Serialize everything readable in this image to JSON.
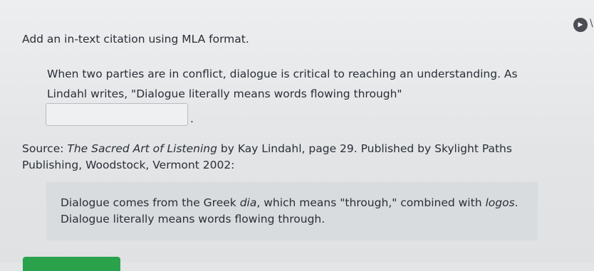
{
  "header": {
    "icon": "play-circle-icon",
    "icon_glyph": "▶",
    "edge_glyph": "\\"
  },
  "question": {
    "prompt": "Add an in-text citation using MLA format.",
    "passage_line1": "When two parties are in conflict, dialogue is critical to reaching an understanding. As",
    "passage_line2": "Lindahl writes, \"Dialogue literally means words flowing through\"",
    "citation_value": "",
    "citation_placeholder": "",
    "period": "."
  },
  "source": {
    "label": "Source: ",
    "book_title": "The Sacred Art of Listening",
    "details": " by Kay Lindahl, page 29. Published by Skylight Paths Publishing, Woodstock, Vermont 2002:"
  },
  "excerpt": {
    "part1": "Dialogue comes from the Greek ",
    "term1": "dia",
    "part2": ", which means \"through,\" combined with ",
    "term2": "logos",
    "part3": ". Dialogue literally means words flowing through."
  },
  "colors": {
    "accent_green": "#29a24b",
    "background": "#e3e5e6",
    "excerpt_background": "#d9dcde"
  }
}
